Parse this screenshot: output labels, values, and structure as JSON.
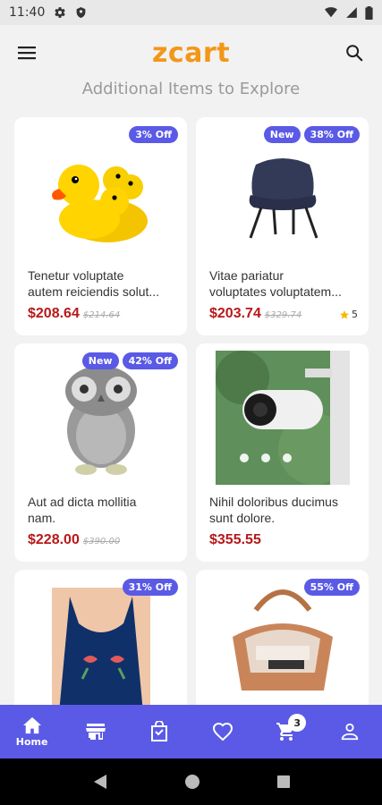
{
  "status_bar": {
    "time": "11:40"
  },
  "app": {
    "logo_text": "zcart"
  },
  "section_title": "Additional Items to Explore",
  "products": [
    {
      "name_line1": "Tenetur voluptate",
      "name_line2": "autem reiciendis solut...",
      "price": "$208.64",
      "old_price": "$214.64",
      "badges": [
        "3% Off"
      ],
      "rating": ""
    },
    {
      "name_line1": "Vitae pariatur",
      "name_line2": "voluptates voluptatem...",
      "price": "$203.74",
      "old_price": "$329.74",
      "badges": [
        "New",
        "38% Off"
      ],
      "rating": "5"
    },
    {
      "name_line1": "Aut ad dicta mollitia",
      "name_line2": "nam.",
      "price": "$228.00",
      "old_price": "$390.00",
      "badges": [
        "New",
        "42% Off"
      ],
      "rating": ""
    },
    {
      "name_line1": "Nihil doloribus ducimus",
      "name_line2": "sunt dolore.",
      "price": "$355.55",
      "old_price": "",
      "badges": [],
      "rating": ""
    },
    {
      "name_line1": "",
      "name_line2": "",
      "price": "",
      "old_price": "",
      "badges": [
        "31% Off"
      ],
      "rating": ""
    },
    {
      "name_line1": "",
      "name_line2": "",
      "price": "",
      "old_price": "",
      "badges": [
        "55% Off"
      ],
      "rating": ""
    }
  ],
  "bottom_nav": {
    "home_label": "Home",
    "cart_count": "3",
    "items": [
      "home-icon",
      "store-icon",
      "bag-icon",
      "heart-icon",
      "cart-icon",
      "account-icon"
    ]
  },
  "colors": {
    "accent": "#5a5ae6",
    "brand": "#f29718",
    "price": "#b81818"
  }
}
